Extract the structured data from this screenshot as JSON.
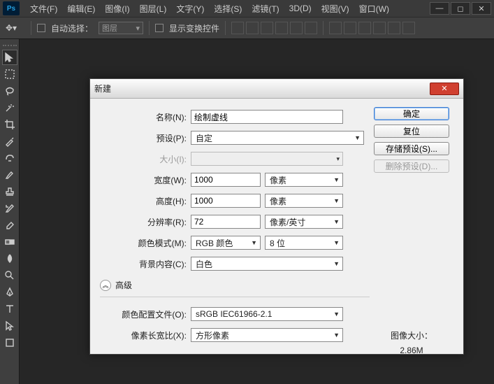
{
  "menu": [
    "文件(F)",
    "编辑(E)",
    "图像(I)",
    "图层(L)",
    "文字(Y)",
    "选择(S)",
    "滤镜(T)",
    "3D(D)",
    "视图(V)",
    "窗口(W)"
  ],
  "optbar": {
    "autoselect": "自动选择：",
    "layer": "图层",
    "transform": "显示变换控件"
  },
  "dialog": {
    "title": "新建",
    "name_lbl": "名称(N):",
    "name_val": "绘制虚线",
    "preset_lbl": "预设(P):",
    "preset_val": "自定",
    "size_lbl": "大小(I):",
    "size_val": "",
    "w_lbl": "宽度(W):",
    "w_val": "1000",
    "w_unit": "像素",
    "h_lbl": "高度(H):",
    "h_val": "1000",
    "h_unit": "像素",
    "res_lbl": "分辨率(R):",
    "res_val": "72",
    "res_unit": "像素/英寸",
    "mode_lbl": "颜色模式(M):",
    "mode_val": "RGB 颜色",
    "bit_val": "8 位",
    "bg_lbl": "背景内容(C):",
    "bg_val": "白色",
    "adv": "高级",
    "profile_lbl": "颜色配置文件(O):",
    "profile_val": "sRGB IEC61966-2.1",
    "par_lbl": "像素长宽比(X):",
    "par_val": "方形像素",
    "ok": "确定",
    "reset": "复位",
    "save": "存储预设(S)...",
    "del": "删除预设(D)...",
    "imgsize_lbl": "图像大小：",
    "imgsize_val": "2.86M"
  }
}
